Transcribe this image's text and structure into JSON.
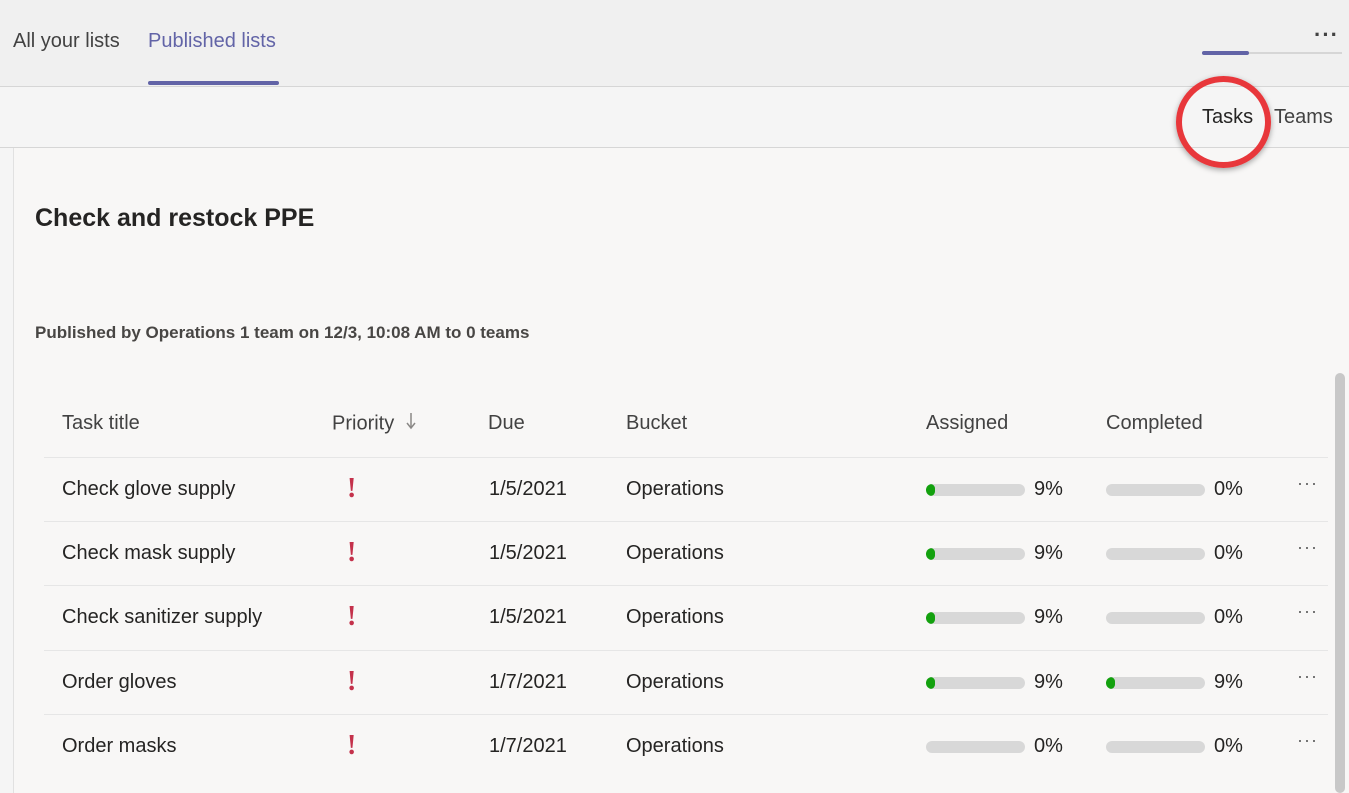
{
  "tabs": [
    {
      "label": "All your lists",
      "active": false
    },
    {
      "label": "Published lists",
      "active": true
    }
  ],
  "top_more_icon": "more-horizontal-icon",
  "view_tabs": [
    {
      "label": "Tasks",
      "active": true
    },
    {
      "label": "Teams",
      "active": false
    }
  ],
  "list": {
    "title": "Check and restock PPE",
    "published_info": "Published by Operations 1 team on 12/3, 10:08 AM to 0 teams"
  },
  "table": {
    "headers": {
      "task_title": "Task title",
      "priority": "Priority",
      "priority_sort_icon": "arrow-down-icon",
      "due": "Due",
      "bucket": "Bucket",
      "assigned": "Assigned",
      "completed": "Completed"
    },
    "rows": [
      {
        "title": "Check glove supply",
        "priority_icon": "!",
        "due": "1/5/2021",
        "bucket": "Operations",
        "assigned": "9%",
        "assigned_value": 0.09,
        "completed": "0%",
        "completed_value": 0.0,
        "more": "···"
      },
      {
        "title": "Check mask supply",
        "priority_icon": "!",
        "due": "1/5/2021",
        "bucket": "Operations",
        "assigned": "9%",
        "assigned_value": 0.09,
        "completed": "0%",
        "completed_value": 0.0,
        "more": "···"
      },
      {
        "title": "Check sanitizer supply",
        "priority_icon": "!",
        "due": "1/5/2021",
        "bucket": "Operations",
        "assigned": "9%",
        "assigned_value": 0.09,
        "completed": "0%",
        "completed_value": 0.0,
        "more": "···"
      },
      {
        "title": "Order gloves",
        "priority_icon": "!",
        "due": "1/7/2021",
        "bucket": "Operations",
        "assigned": "9%",
        "assigned_value": 0.09,
        "completed": "9%",
        "completed_value": 0.09,
        "more": "···"
      },
      {
        "title": "Order masks",
        "priority_icon": "!",
        "due": "1/7/2021",
        "bucket": "Operations",
        "assigned": "0%",
        "assigned_value": 0.0,
        "completed": "0%",
        "completed_value": 0.0,
        "more": "···"
      }
    ]
  },
  "colors": {
    "accent": "#6264a7",
    "priority_urgent": "#c4314b",
    "progress": "#13a10e",
    "highlight_ring": "#e8373b"
  }
}
